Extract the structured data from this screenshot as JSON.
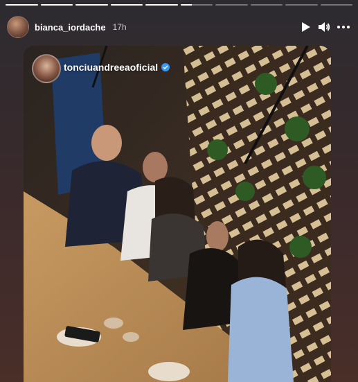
{
  "story": {
    "username": "bianca_iordache",
    "time": "17h",
    "progress": [
      1,
      1,
      1,
      1,
      1,
      0.35,
      0,
      0,
      0,
      0
    ]
  },
  "repost": {
    "username": "tonciuandreeaoficial",
    "verified": true
  },
  "icons": {
    "play": "play-icon",
    "volume": "volume-icon",
    "more": "more-options-icon"
  },
  "colors": {
    "verified_blue": "#3897f0",
    "text": "#ffffff"
  }
}
